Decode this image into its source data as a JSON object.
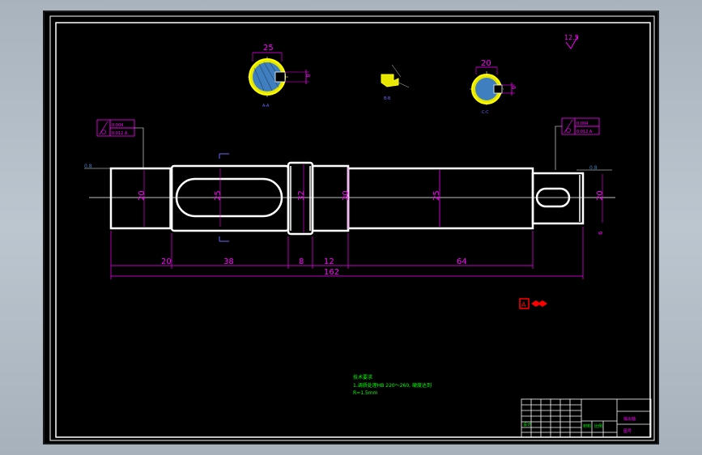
{
  "colors": {
    "background": "#000000",
    "outline": "#ffffff",
    "dimension": "#ff00ff",
    "annotation": "#ffff00",
    "note": "#00ff00",
    "centerline": "#ffffff",
    "hatch": "#3f7fbf",
    "leader": "#6666ff",
    "datum": "#ff0000"
  },
  "roughness_symbol": "12.5",
  "section_views": {
    "left_diameter": "25",
    "left_keyway_depth": "8",
    "right_diameter": "20",
    "right_keyway_depth": "6",
    "view_marks": [
      "A-A",
      "B-B",
      "C-C"
    ]
  },
  "shaft": {
    "diameters": [
      "20",
      "25",
      "32",
      "30",
      "25",
      "20"
    ],
    "segment_lengths": [
      "20",
      "38",
      "8",
      "12",
      "64"
    ],
    "total_length": "162",
    "right_end_mark": "6"
  },
  "tolerance_frames": {
    "left": [
      "0.004",
      "0.012 A"
    ],
    "right": [
      "0.004",
      "0.012 A"
    ]
  },
  "surface_marks": {
    "left": "0.8",
    "right": "0.8"
  },
  "datum_symbol": "A",
  "notes": [
    "技术要求",
    "1.调质处理HB 220～260, 硬度达到",
    "R=1.5mm"
  ],
  "title_block": {
    "part_name": "输出轴",
    "drawing_no": "图号",
    "label_material": "材料",
    "label_scale": "比例",
    "label_design": "设计"
  }
}
